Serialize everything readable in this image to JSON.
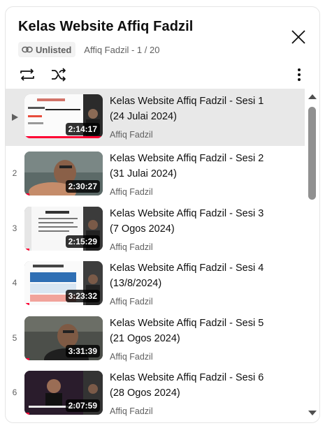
{
  "playlist": {
    "title": "Kelas Website Affiq Fadzil",
    "privacy": "Unlisted",
    "meta": "Affiq Fadzil - 1 / 20"
  },
  "icons": {
    "close": "close-icon",
    "link": "link-icon",
    "loop": "loop-icon",
    "shuffle": "shuffle-icon",
    "more": "more-vert-icon",
    "now_playing": "play-arrow-icon"
  },
  "colors": {
    "accent": "#ff0033",
    "active_row": "#e8e8e8",
    "secondary_text": "#606060"
  },
  "videos": [
    {
      "index": "▶",
      "title": "Kelas Website Affiq Fadzil - Sesi 1 (24 Julai 2024)",
      "channel": "Affiq Fadzil",
      "duration": "2:14:17",
      "progress": 1.0,
      "active": true
    },
    {
      "index": "2",
      "title": "Kelas Website Affiq Fadzil - Sesi 2 (31 Julai 2024)",
      "channel": "Affiq Fadzil",
      "duration": "2:30:27",
      "progress": 0.06,
      "active": false
    },
    {
      "index": "3",
      "title": "Kelas Website Affiq Fadzil - Sesi 3 (7 Ogos 2024)",
      "channel": "Affiq Fadzil",
      "duration": "2:15:29",
      "progress": 0.06,
      "active": false
    },
    {
      "index": "4",
      "title": "Kelas Website Affiq Fadzil - Sesi 4 (13/8/2024)",
      "channel": "Affiq Fadzil",
      "duration": "3:23:32",
      "progress": 0.06,
      "active": false
    },
    {
      "index": "5",
      "title": "Kelas Website Affiq Fadzil - Sesi 5 (21 Ogos 2024)",
      "channel": "Affiq Fadzil",
      "duration": "3:31:39",
      "progress": 0.06,
      "active": false
    },
    {
      "index": "6",
      "title": "Kelas Website Affiq Fadzil - Sesi 6 (28 Ogos 2024)",
      "channel": "Affiq Fadzil",
      "duration": "2:07:59",
      "progress": 0.06,
      "active": false
    }
  ]
}
